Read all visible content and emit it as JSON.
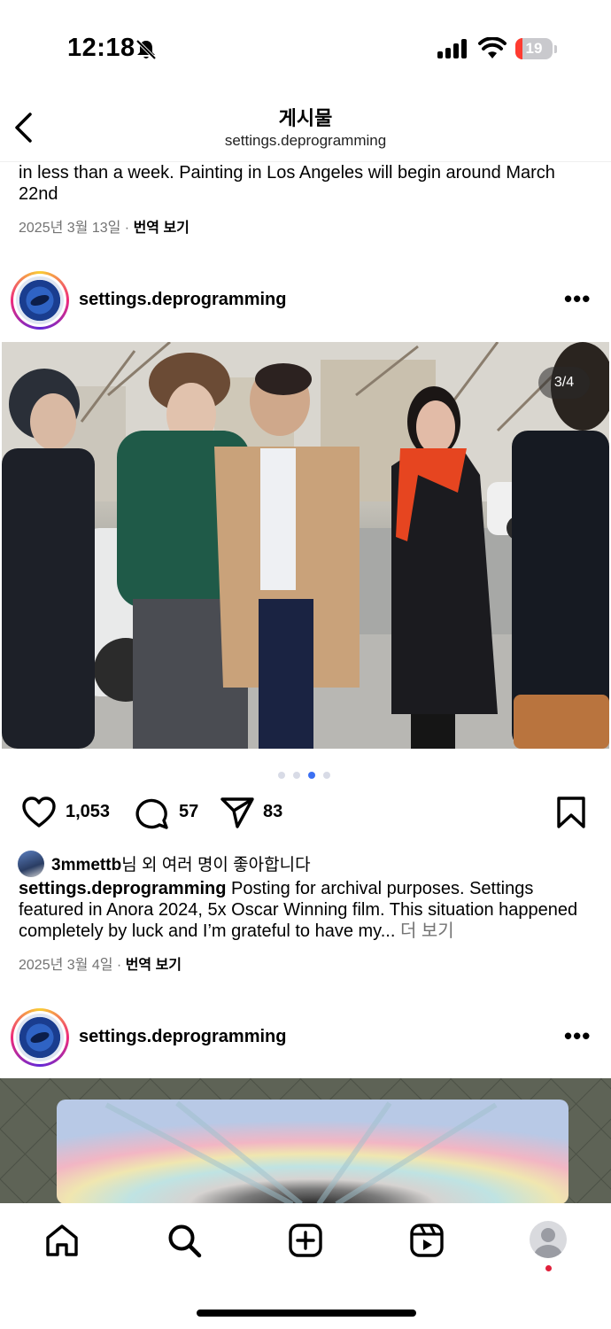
{
  "status": {
    "time": "12:18",
    "battery": "19"
  },
  "header": {
    "title": "게시물",
    "subtitle": "settings.deprogramming"
  },
  "prev_post": {
    "caption_tail": "in less than a week. Painting in Los Angeles will begin around March 22nd",
    "date": "2025년 3월 13일",
    "translate": "번역 보기"
  },
  "post": {
    "username": "settings.deprogramming",
    "more": "•••",
    "carousel_counter": "3/4",
    "carousel_index": 3,
    "carousel_total": 4,
    "likes": "1,053",
    "comments": "57",
    "shares": "83",
    "liked_by_user": "3mmettb",
    "liked_by_suffix": "님 외 여러 명이 좋아합니다",
    "caption_user": "settings.deprogramming",
    "caption": "Posting for archival purposes. Settings featured in Anora 2024, 5x Oscar Winning film. This situation happened completely by luck and I’m grateful to have my...",
    "more_link": "더 보기",
    "date": "2025년 3월 4일",
    "translate": "번역 보기"
  },
  "next_post": {
    "username": "settings.deprogramming",
    "more": "•••"
  },
  "tabbar": {
    "items": [
      "home-icon",
      "search-icon",
      "create-icon",
      "reels-icon",
      "profile-avatar"
    ]
  },
  "colors": {
    "accent": "#3b6ff2",
    "notify": "#e0203b"
  }
}
